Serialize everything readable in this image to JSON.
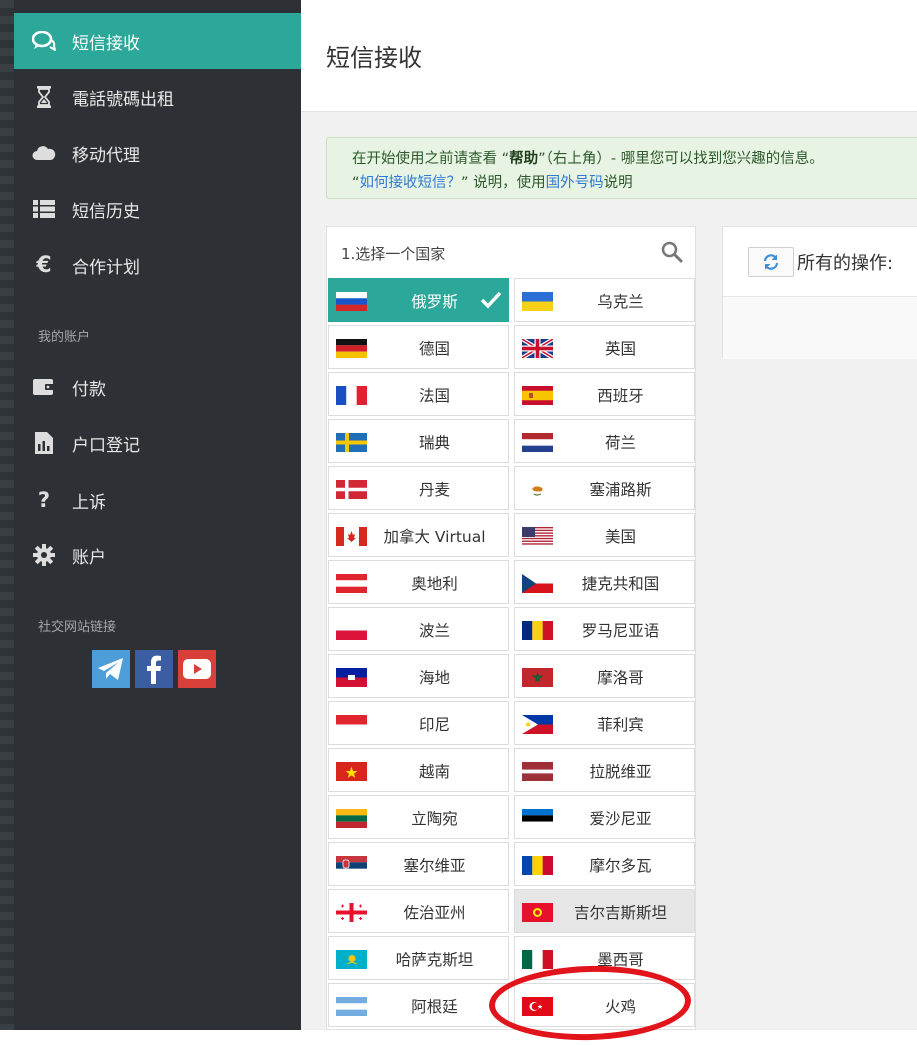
{
  "sidebar": {
    "items": [
      {
        "label": "短信接收",
        "icon": "chat-bubbles-icon"
      },
      {
        "label": "電話號碼出租",
        "icon": "hourglass-icon"
      },
      {
        "label": "移动代理",
        "icon": "cloud-icon"
      },
      {
        "label": "短信历史",
        "icon": "list-icon"
      },
      {
        "label": "合作计划",
        "icon": "euro-icon"
      }
    ],
    "account_title": "我的账户",
    "account_items": [
      {
        "label": "付款",
        "icon": "wallet-icon"
      },
      {
        "label": "户口登记",
        "icon": "report-icon"
      },
      {
        "label": "上诉",
        "icon": "question-icon"
      },
      {
        "label": "账户",
        "icon": "gear-icon"
      }
    ],
    "social_title": "社交网站链接",
    "social": [
      "telegram-icon",
      "facebook-icon",
      "youtube-icon"
    ]
  },
  "header": {
    "title": "短信接收"
  },
  "alert": {
    "line1_pre": "在开始使用之前请查看 “",
    "line1_bold": "帮助",
    "line1_post": "”（右上角）- 哪里您可以找到您兴趣的信息。",
    "line2_q1": "“",
    "line2_link1": "如何接收短信？",
    "line2_mid": "” 说明，使用",
    "line2_link2": "国外号码",
    "line2_end": "说明"
  },
  "country_select": {
    "label": "1.选择一个国家",
    "selected": "俄罗斯",
    "countries": [
      "俄罗斯",
      "乌克兰",
      "德国",
      "英国",
      "法国",
      "西班牙",
      "瑞典",
      "荷兰",
      "丹麦",
      "塞浦路斯",
      "加拿大 Virtual",
      "美国",
      "奥地利",
      "捷克共和国",
      "波兰",
      "罗马尼亚语",
      "海地",
      "摩洛哥",
      "印尼",
      "菲利宾",
      "越南",
      "拉脱维亚",
      "立陶宛",
      "爱沙尼亚",
      "塞尔维亚",
      "摩尔多瓦",
      "佐治亚州",
      "吉尔吉斯斯坦",
      "哈萨克斯坦",
      "墨西哥",
      "阿根廷",
      "火鸡"
    ]
  },
  "operations": {
    "label": "所有的操作:"
  },
  "colors": {
    "accent": "#2ba89a",
    "sidebar": "#2d3034",
    "annotation": "#e2141b"
  }
}
